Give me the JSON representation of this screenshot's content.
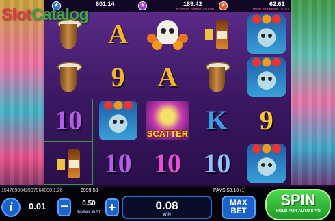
{
  "logo": {
    "text_slot": "Slot",
    "text_catalog": "Catalog"
  },
  "jackpots": [
    {
      "icon": "star-icon",
      "color": "#2e6fd8",
      "value": "601.14",
      "note": ""
    },
    {
      "icon": "star-icon",
      "color": "#a23fd8",
      "value": "189.42",
      "note": "must hit before 250.00"
    },
    {
      "icon": "star-icon",
      "color": "#e8541f",
      "value": "62.61",
      "note": "must hit before 75.00"
    }
  ],
  "reels": [
    [
      {
        "sym": "drum"
      },
      {
        "sym": "drum"
      },
      {
        "sym": "10",
        "color": "purple",
        "framed": true
      },
      {
        "sym": "bottle",
        "framed": true
      }
    ],
    [
      {
        "sym": "A",
        "color": "gold"
      },
      {
        "sym": "9",
        "color": "gold"
      },
      {
        "sym": "lady"
      },
      {
        "sym": "10",
        "color": "purple"
      }
    ],
    [
      {
        "sym": "skull"
      },
      {
        "sym": "A",
        "color": "gold"
      },
      {
        "sym": "scatter",
        "label": "SCATTER"
      },
      {
        "sym": "10",
        "color": "magenta"
      }
    ],
    [
      {
        "sym": "bottle"
      },
      {
        "sym": "drum"
      },
      {
        "sym": "K",
        "color": "blue"
      },
      {
        "sym": "10",
        "color": "ltblue"
      }
    ],
    [
      {
        "sym": "lady"
      },
      {
        "sym": "lady"
      },
      {
        "sym": "9",
        "color": "yellow"
      },
      {
        "sym": "lady"
      }
    ]
  ],
  "status": {
    "game_id": "1547090042997964800.1.26",
    "balance": "$999.58",
    "pays": "PAYS $0.10  (1)"
  },
  "controls": {
    "info_label": "i",
    "coin_value": "0.01",
    "minus_label": "−",
    "plus_label": "+",
    "total_bet_value": "0.50",
    "total_bet_label": "TOTAL BET",
    "win_value": "0.08",
    "win_label": "WIN",
    "maxbet_line1": "MAX",
    "maxbet_line2": "BET",
    "spin_label": "SPIN",
    "spin_sub": "HOLD FOR AUTO SPIN"
  },
  "colors": {
    "accent": "#1b63c8",
    "spin": "#2fb83a",
    "reel_bg": "#3b1863"
  }
}
